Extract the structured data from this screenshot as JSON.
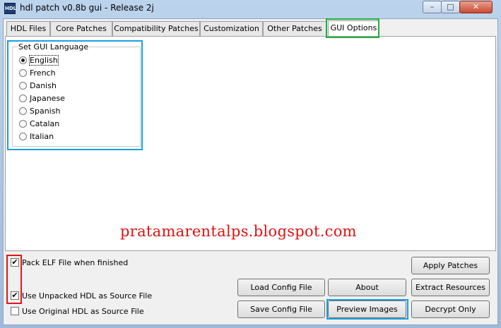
{
  "window": {
    "title": "hdl patch v0.8b gui - Release 2j",
    "icon": "app-icon",
    "controls": {
      "minimize": "–",
      "maximize": "□",
      "close": "✕"
    }
  },
  "tabs": [
    {
      "label": "HDL Files",
      "active": false
    },
    {
      "label": "Core Patches",
      "active": false
    },
    {
      "label": "Compatibility Patches",
      "active": false
    },
    {
      "label": "Customization",
      "active": false
    },
    {
      "label": "Other Patches",
      "active": false
    },
    {
      "label": "GUI Options",
      "active": true
    }
  ],
  "gui_options": {
    "group_label": "Set GUI Language",
    "languages": [
      {
        "label": "English",
        "selected": true
      },
      {
        "label": "French",
        "selected": false
      },
      {
        "label": "Danish",
        "selected": false
      },
      {
        "label": "Japanese",
        "selected": false
      },
      {
        "label": "Spanish",
        "selected": false
      },
      {
        "label": "Catalan",
        "selected": false
      },
      {
        "label": "Italian",
        "selected": false
      }
    ]
  },
  "watermark": "pratamarentalps.blogspot.com",
  "checkboxes": [
    {
      "label": "Pack ELF File when finished",
      "checked": true,
      "check_mark": "✔"
    },
    {
      "label": "Use Unpacked HDL as Source File",
      "checked": true,
      "check_mark": "✔"
    },
    {
      "label": "Use Original HDL as Source File",
      "checked": false,
      "check_mark": ""
    }
  ],
  "buttons": {
    "load_config": "Load Config File",
    "save_config": "Save Config File",
    "about": "About",
    "preview_images": "Preview Images",
    "apply_patches": "Apply Patches",
    "extract_resources": "Extract Resources",
    "decrypt_only": "Decrypt Only"
  },
  "colors": {
    "highlight_blue": "#1aa0e0",
    "highlight_green": "#20b040",
    "highlight_red": "#e01818",
    "watermark": "#e01010"
  }
}
